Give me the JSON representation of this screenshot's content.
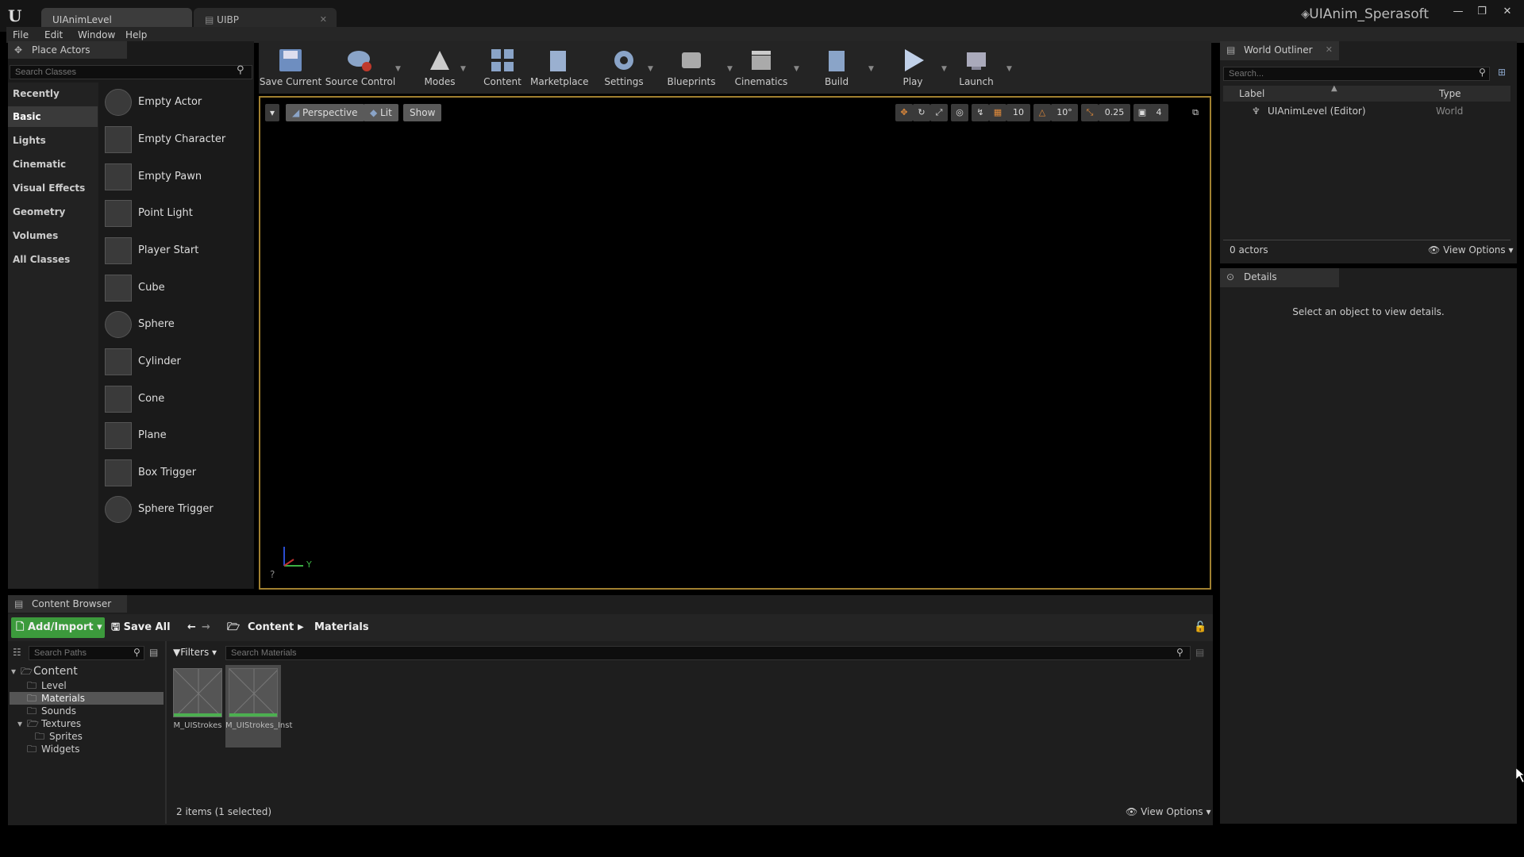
{
  "window": {
    "tabs": [
      {
        "label": "UIAnimLevel"
      },
      {
        "label": "UIBP"
      }
    ],
    "project_name": "UIAnim_Sperasoft",
    "controls": [
      "—",
      "❐",
      "✕"
    ]
  },
  "menu": [
    "File",
    "Edit",
    "Window",
    "Help"
  ],
  "place_actors": {
    "title": "Place Actors",
    "search_placeholder": "Search Classes",
    "categories": [
      "Recently Placed",
      "Basic",
      "Lights",
      "Cinematic",
      "Visual Effects",
      "Geometry",
      "Volumes",
      "All Classes"
    ],
    "active_category": "Basic",
    "items": [
      "Empty Actor",
      "Empty Character",
      "Empty Pawn",
      "Point Light",
      "Player Start",
      "Cube",
      "Sphere",
      "Cylinder",
      "Cone",
      "Plane",
      "Box Trigger",
      "Sphere Trigger"
    ]
  },
  "toolbar": {
    "items": [
      {
        "label": "Save Current",
        "icon": "save-icon"
      },
      {
        "label": "Source Control",
        "icon": "source-control-icon"
      },
      {
        "label": "Modes",
        "icon": "modes-icon"
      },
      {
        "label": "Content",
        "icon": "content-icon"
      },
      {
        "label": "Marketplace",
        "icon": "marketplace-icon"
      },
      {
        "label": "Settings",
        "icon": "settings-icon"
      },
      {
        "label": "Blueprints",
        "icon": "blueprints-icon"
      },
      {
        "label": "Cinematics",
        "icon": "cinematics-icon"
      },
      {
        "label": "Build",
        "icon": "build-icon"
      },
      {
        "label": "Play",
        "icon": "play-icon"
      },
      {
        "label": "Launch",
        "icon": "launch-icon"
      }
    ]
  },
  "viewport": {
    "perspective": "Perspective",
    "lit": "Lit",
    "show": "Show",
    "grid_snap": "10",
    "rotation_snap": "10°",
    "scale_snap": "0.25",
    "camera_speed": "4",
    "axis_y": "Y",
    "border_color": "#a08030"
  },
  "world_outliner": {
    "title": "World Outliner",
    "search_placeholder": "Search...",
    "col_label": "Label",
    "col_type": "Type",
    "rows": [
      {
        "label": "UIAnimLevel (Editor)",
        "type": "World"
      }
    ],
    "actor_count": "0 actors",
    "view_options": "View Options"
  },
  "details": {
    "title": "Details",
    "empty_message": "Select an object to view details."
  },
  "content_browser": {
    "title": "Content Browser",
    "add_import": "Add/Import",
    "save_all": "Save All",
    "path": [
      "Content",
      "Materials"
    ],
    "search_paths_placeholder": "Search Paths",
    "filters": "Filters",
    "search_placeholder": "Search Materials",
    "tree": [
      "Content",
      "Level",
      "Materials",
      "Sounds",
      "Textures",
      "Sprites",
      "Widgets"
    ],
    "selected_folder": "Materials",
    "assets": [
      {
        "name": "M_UIStrokes"
      },
      {
        "name": "M_UIStrokes_Inst"
      }
    ],
    "status": "2 items (1 selected)",
    "view_options": "View Options",
    "accent_color": "#4caf50"
  }
}
